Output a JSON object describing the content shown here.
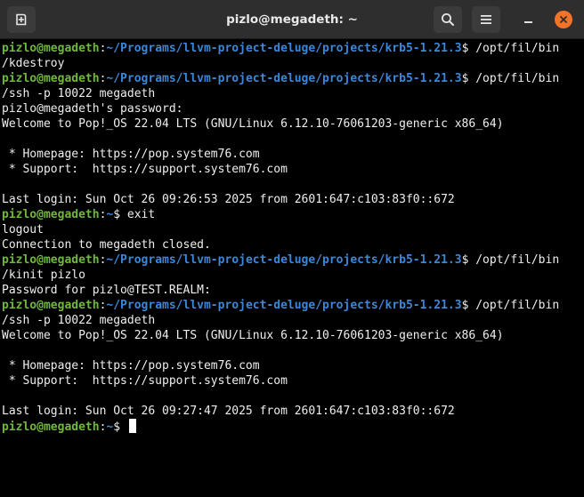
{
  "window": {
    "title": "pizlo@megadeth: ~"
  },
  "icons": {
    "new_tab": "new-tab-icon",
    "search": "search-icon",
    "menu": "hamburger-menu-icon",
    "minimize": "minimize-icon",
    "close": "close-icon"
  },
  "colors": {
    "prompt_user": "#6eb83c",
    "prompt_path": "#3c87d7",
    "text": "#eeeeec",
    "close_button": "#f37329",
    "titlebar": "#2e2e2e"
  },
  "terminal": {
    "lines": [
      [
        {
          "t": "pizlo@megadeth",
          "c": "user"
        },
        {
          "t": ":"
        },
        {
          "t": "~/Programs/llvm-project-deluge/projects/krb5-1.21.3",
          "c": "path"
        },
        {
          "t": "$ /opt/fil/bin"
        }
      ],
      [
        {
          "t": "/kdestroy"
        }
      ],
      [
        {
          "t": "pizlo@megadeth",
          "c": "user"
        },
        {
          "t": ":"
        },
        {
          "t": "~/Programs/llvm-project-deluge/projects/krb5-1.21.3",
          "c": "path"
        },
        {
          "t": "$ /opt/fil/bin"
        }
      ],
      [
        {
          "t": "/ssh -p 10022 megadeth"
        }
      ],
      [
        {
          "t": "pizlo@megadeth's password:"
        }
      ],
      [
        {
          "t": "Welcome to Pop!_OS 22.04 LTS (GNU/Linux 6.12.10-76061203-generic x86_64)"
        }
      ],
      [
        {
          "t": ""
        }
      ],
      [
        {
          "t": " * Homepage: https://pop.system76.com"
        }
      ],
      [
        {
          "t": " * Support:  https://support.system76.com"
        }
      ],
      [
        {
          "t": ""
        }
      ],
      [
        {
          "t": "Last login: Sun Oct 26 09:26:53 2025 from 2601:647:c103:83f0::672"
        }
      ],
      [
        {
          "t": "pizlo@megadeth",
          "c": "user"
        },
        {
          "t": ":"
        },
        {
          "t": "~",
          "c": "path"
        },
        {
          "t": "$ exit"
        }
      ],
      [
        {
          "t": "logout"
        }
      ],
      [
        {
          "t": "Connection to megadeth closed."
        }
      ],
      [
        {
          "t": "pizlo@megadeth",
          "c": "user"
        },
        {
          "t": ":"
        },
        {
          "t": "~/Programs/llvm-project-deluge/projects/krb5-1.21.3",
          "c": "path"
        },
        {
          "t": "$ /opt/fil/bin"
        }
      ],
      [
        {
          "t": "/kinit pizlo"
        }
      ],
      [
        {
          "t": "Password for pizlo@TEST.REALM:"
        }
      ],
      [
        {
          "t": "pizlo@megadeth",
          "c": "user"
        },
        {
          "t": ":"
        },
        {
          "t": "~/Programs/llvm-project-deluge/projects/krb5-1.21.3",
          "c": "path"
        },
        {
          "t": "$ /opt/fil/bin"
        }
      ],
      [
        {
          "t": "/ssh -p 10022 megadeth"
        }
      ],
      [
        {
          "t": "Welcome to Pop!_OS 22.04 LTS (GNU/Linux 6.12.10-76061203-generic x86_64)"
        }
      ],
      [
        {
          "t": ""
        }
      ],
      [
        {
          "t": " * Homepage: https://pop.system76.com"
        }
      ],
      [
        {
          "t": " * Support:  https://support.system76.com"
        }
      ],
      [
        {
          "t": ""
        }
      ],
      [
        {
          "t": "Last login: Sun Oct 26 09:27:47 2025 from 2601:647:c103:83f0::672"
        }
      ],
      [
        {
          "t": "pizlo@megadeth",
          "c": "user"
        },
        {
          "t": ":"
        },
        {
          "t": "~",
          "c": "path"
        },
        {
          "t": "$ "
        }
      ]
    ]
  }
}
